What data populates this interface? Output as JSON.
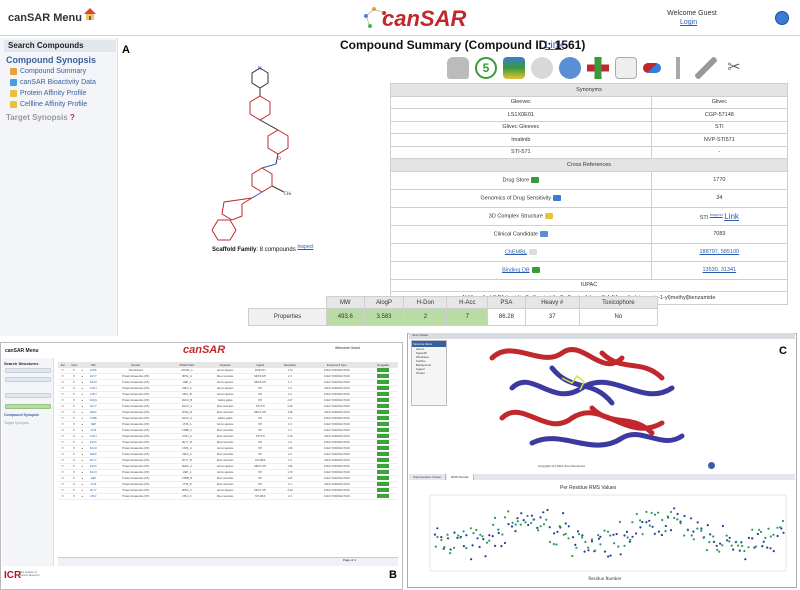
{
  "topbar": {
    "menu_title": "canSAR Menu",
    "logo": "canSAR",
    "welcome": "Welcome Guest",
    "login": "Login"
  },
  "panel_labels": {
    "a": "A",
    "b": "B",
    "c": "C"
  },
  "sidebar": {
    "search_header": "Search Compounds",
    "synopsis": "Compound Synopsis",
    "items": [
      {
        "label": "Compound Summary",
        "color": "#e8a43a"
      },
      {
        "label": "canSAR Bioactivity Data",
        "color": "#4a9ee0"
      },
      {
        "label": "Protein Affinity Profile",
        "color": "#e8c23a"
      },
      {
        "label": "Cellline Affinity Profile",
        "color": "#e8c23a"
      }
    ],
    "target_synopsis": "Target Synopsis"
  },
  "compound": {
    "title": "Compound Summary (Compound ID: 1561)",
    "link_label": "Link",
    "scaffold_label": "Scaffold Family",
    "scaffold_count": ": 8 compounds",
    "inspect": "Inspect"
  },
  "synonyms": {
    "header": "Synonyms",
    "rows": [
      [
        "Gleevec",
        "Glivec"
      ],
      [
        "LS1X0E01",
        "CGP-57148"
      ],
      [
        "Glivec Gleevec",
        "STI"
      ],
      [
        "Imatinib",
        "NVP-STI571"
      ],
      [
        "STI-571",
        "-"
      ]
    ],
    "xref_header": "Cross References",
    "xrefs": [
      {
        "label": "Drug Store",
        "value": "1770"
      },
      {
        "label": "Genomics of Drug Sensitivity",
        "value": "34"
      },
      {
        "label": "3D Complex Structure",
        "value": "STI"
      },
      {
        "label": "Clinical Candidate",
        "value": "7083"
      },
      {
        "label": "ChEMBL",
        "value": "188797, 585100"
      },
      {
        "label": "Binding DB",
        "value": "13530, 31341"
      }
    ],
    "complex_inspect": "Inspect",
    "complex_link": "Link",
    "iupac_header": "IUPAC",
    "iupac": "N-[4-methyl-3-[[4-(pyridin-3-yl)pyrimidin-2-yl]amino]phenyl]-4-[(4-methylpiperazin-1-yl)methyl]benzamide"
  },
  "properties": {
    "row_label": "Properties",
    "headers": [
      "MW",
      "AlogP",
      "H-Don",
      "H-Acc",
      "PSA",
      "Heavy #",
      "Toxicophore"
    ],
    "values": [
      "493.6",
      "3.583",
      "2",
      "7",
      "86.28",
      "37",
      "No"
    ]
  },
  "panel_b": {
    "menu_title": "canSAR Menu",
    "logo": "canSAR",
    "welcome": "Welcome Guest",
    "search_title": "Search Structures",
    "compound_synopsis": "Compound Synopsis",
    "target_synopsis": "Target Synopsis",
    "columns": [
      "Sel",
      "View",
      "",
      "Pdb",
      "Domain",
      "PFAM Chain",
      "Organism",
      "Ligand",
      "Resolution",
      "Experiment Type",
      "Druggable"
    ],
    "rows": [
      [
        "1XKK",
        "Transcription",
        "1FXRF_A",
        "Homo sapiens",
        "FMD-STI",
        "1.70",
        "X-RAY DIFFRACTION"
      ],
      [
        "2HYY",
        "Protein kinase-like (PK)",
        "3K5G_A",
        "Mus musculus",
        "MKK6-STI",
        "2.4",
        "X-RAY DIFFRACTION"
      ],
      [
        "3GVU",
        "Protein kinase-like (PK)",
        "1IEP_A",
        "Homo sapiens",
        "MKK6-STI",
        "1.7",
        "X-RAY DIFFRACTION"
      ],
      [
        "1OPJ",
        "Protein kinase-like (PK)",
        "3KF4_A",
        "Homo sapiens",
        "STI",
        "2.4",
        "X-RAY DIFFRACTION"
      ],
      [
        "1OPJ",
        "Protein kinase-like (PK)",
        "3KF4_B",
        "Homo sapiens",
        "STI",
        "2.4",
        "X-RAY DIFFRACTION"
      ],
      [
        "2GQG",
        "Protein kinase-like (PK)",
        "3GVU_B",
        "Gallus gallus",
        "STI",
        "2.07",
        "X-RAY DIFFRACTION"
      ],
      [
        "2HYY",
        "Protein kinase-like (PK)",
        "3GVU_A",
        "Mus musculus",
        "STI-STI",
        "2.40",
        "X-RAY DIFFRACTION"
      ],
      [
        "3HEC",
        "Protein kinase-like (PK)",
        "3K5G_B",
        "Mus musculus",
        "MKK7-STI",
        "1.96",
        "X-RAY DIFFRACTION"
      ],
      [
        "1XBB",
        "Protein kinase-like (PK)",
        "3GVU_A",
        "Gallus gallus",
        "STI",
        "2.4",
        "X-RAY DIFFRACTION"
      ],
      [
        "1IEP",
        "Protein kinase-like (PK)",
        "1T46_A",
        "Homo sapiens",
        "STI",
        "1.6",
        "X-RAY DIFFRACTION"
      ],
      [
        "1T46",
        "Protein kinase-like (PK)",
        "1XBB_A",
        "Mus musculus",
        "STI",
        "2.1",
        "X-RAY DIFFRACTION"
      ],
      [
        "1OPJ",
        "Protein kinase-like (PK)",
        "1OPJ_A",
        "Mus musculus",
        "STI-STI",
        "2.40",
        "X-RAY DIFFRACTION"
      ],
      [
        "3GVU",
        "Protein kinase-like (PK)",
        "3HYY_B",
        "Mus musculus",
        "STI",
        "2.4",
        "X-RAY DIFFRACTION"
      ],
      [
        "3GVU",
        "Protein kinase-like (PK)",
        "1XKK_A",
        "Homo sapiens",
        "STI",
        "1.96",
        "X-RAY DIFFRACTION"
      ],
      [
        "3HEC",
        "Protein kinase-like (PK)",
        "2PL0_A",
        "Mus musculus",
        "STI",
        "2.2",
        "X-RAY DIFFRACTION"
      ],
      [
        "2HYY",
        "Protein kinase-like (PK)",
        "2HYY_B",
        "Mus musculus",
        "STI-MKK",
        "2.4",
        "X-RAY DIFFRACTION"
      ],
      [
        "3GVU",
        "Protein kinase-like (PK)",
        "3HEC_A",
        "Homo sapiens",
        "MKK7-STI",
        "1.96",
        "X-RAY DIFFRACTION"
      ],
      [
        "3GVU",
        "Protein kinase-like (PK)",
        "1IEP_A",
        "Homo sapiens",
        "STI",
        "1.70",
        "X-RAY DIFFRACTION"
      ],
      [
        "1IEP",
        "Protein kinase-like (PK)",
        "1XBB_B",
        "Mus musculus",
        "STI",
        "1.97",
        "X-RAY DIFFRACTION"
      ],
      [
        "1T46",
        "Protein kinase-like (PK)",
        "1T46_B",
        "Mus musculus",
        "STI",
        "2.1",
        "X-RAY DIFFRACTION"
      ],
      [
        "2HYY",
        "Protein kinase-like (PK)",
        "3K5G_C",
        "Homo sapiens",
        "MKK7-STI",
        "2.40",
        "X-RAY DIFFRACTION"
      ],
      [
        "2PL0",
        "Protein kinase-like (PK)",
        "2PL0_C",
        "Mus musculus",
        "STI-MKK",
        "2.4",
        "X-RAY DIFFRACTION"
      ]
    ],
    "footer_page": "Page",
    "footer_of": "of 1",
    "icr": "ICR",
    "icr_sub": "The Institute of Cancer Research"
  },
  "panel_c": {
    "header": "Jmol Viewer",
    "menu": [
      "Structure Menu",
      "Atoms",
      "Spacefill",
      "Wireframe",
      "Surface",
      "Background",
      "Ligand",
      "Pocket"
    ],
    "caption": "Copyright (C) 2013 Jmol Structures",
    "tabs": [
      "Superposition Viewer",
      "RMS Results"
    ],
    "chart_title": "Per Residue RMS Values",
    "x_label": "Residue Number"
  },
  "chart_data": {
    "type": "scatter",
    "title": "Per Residue RMS Values",
    "xlabel": "Residue Number",
    "series": [
      {
        "name": "",
        "color": "#2b3aa0"
      },
      {
        "name": "",
        "color": "#2a9a5a"
      }
    ]
  }
}
